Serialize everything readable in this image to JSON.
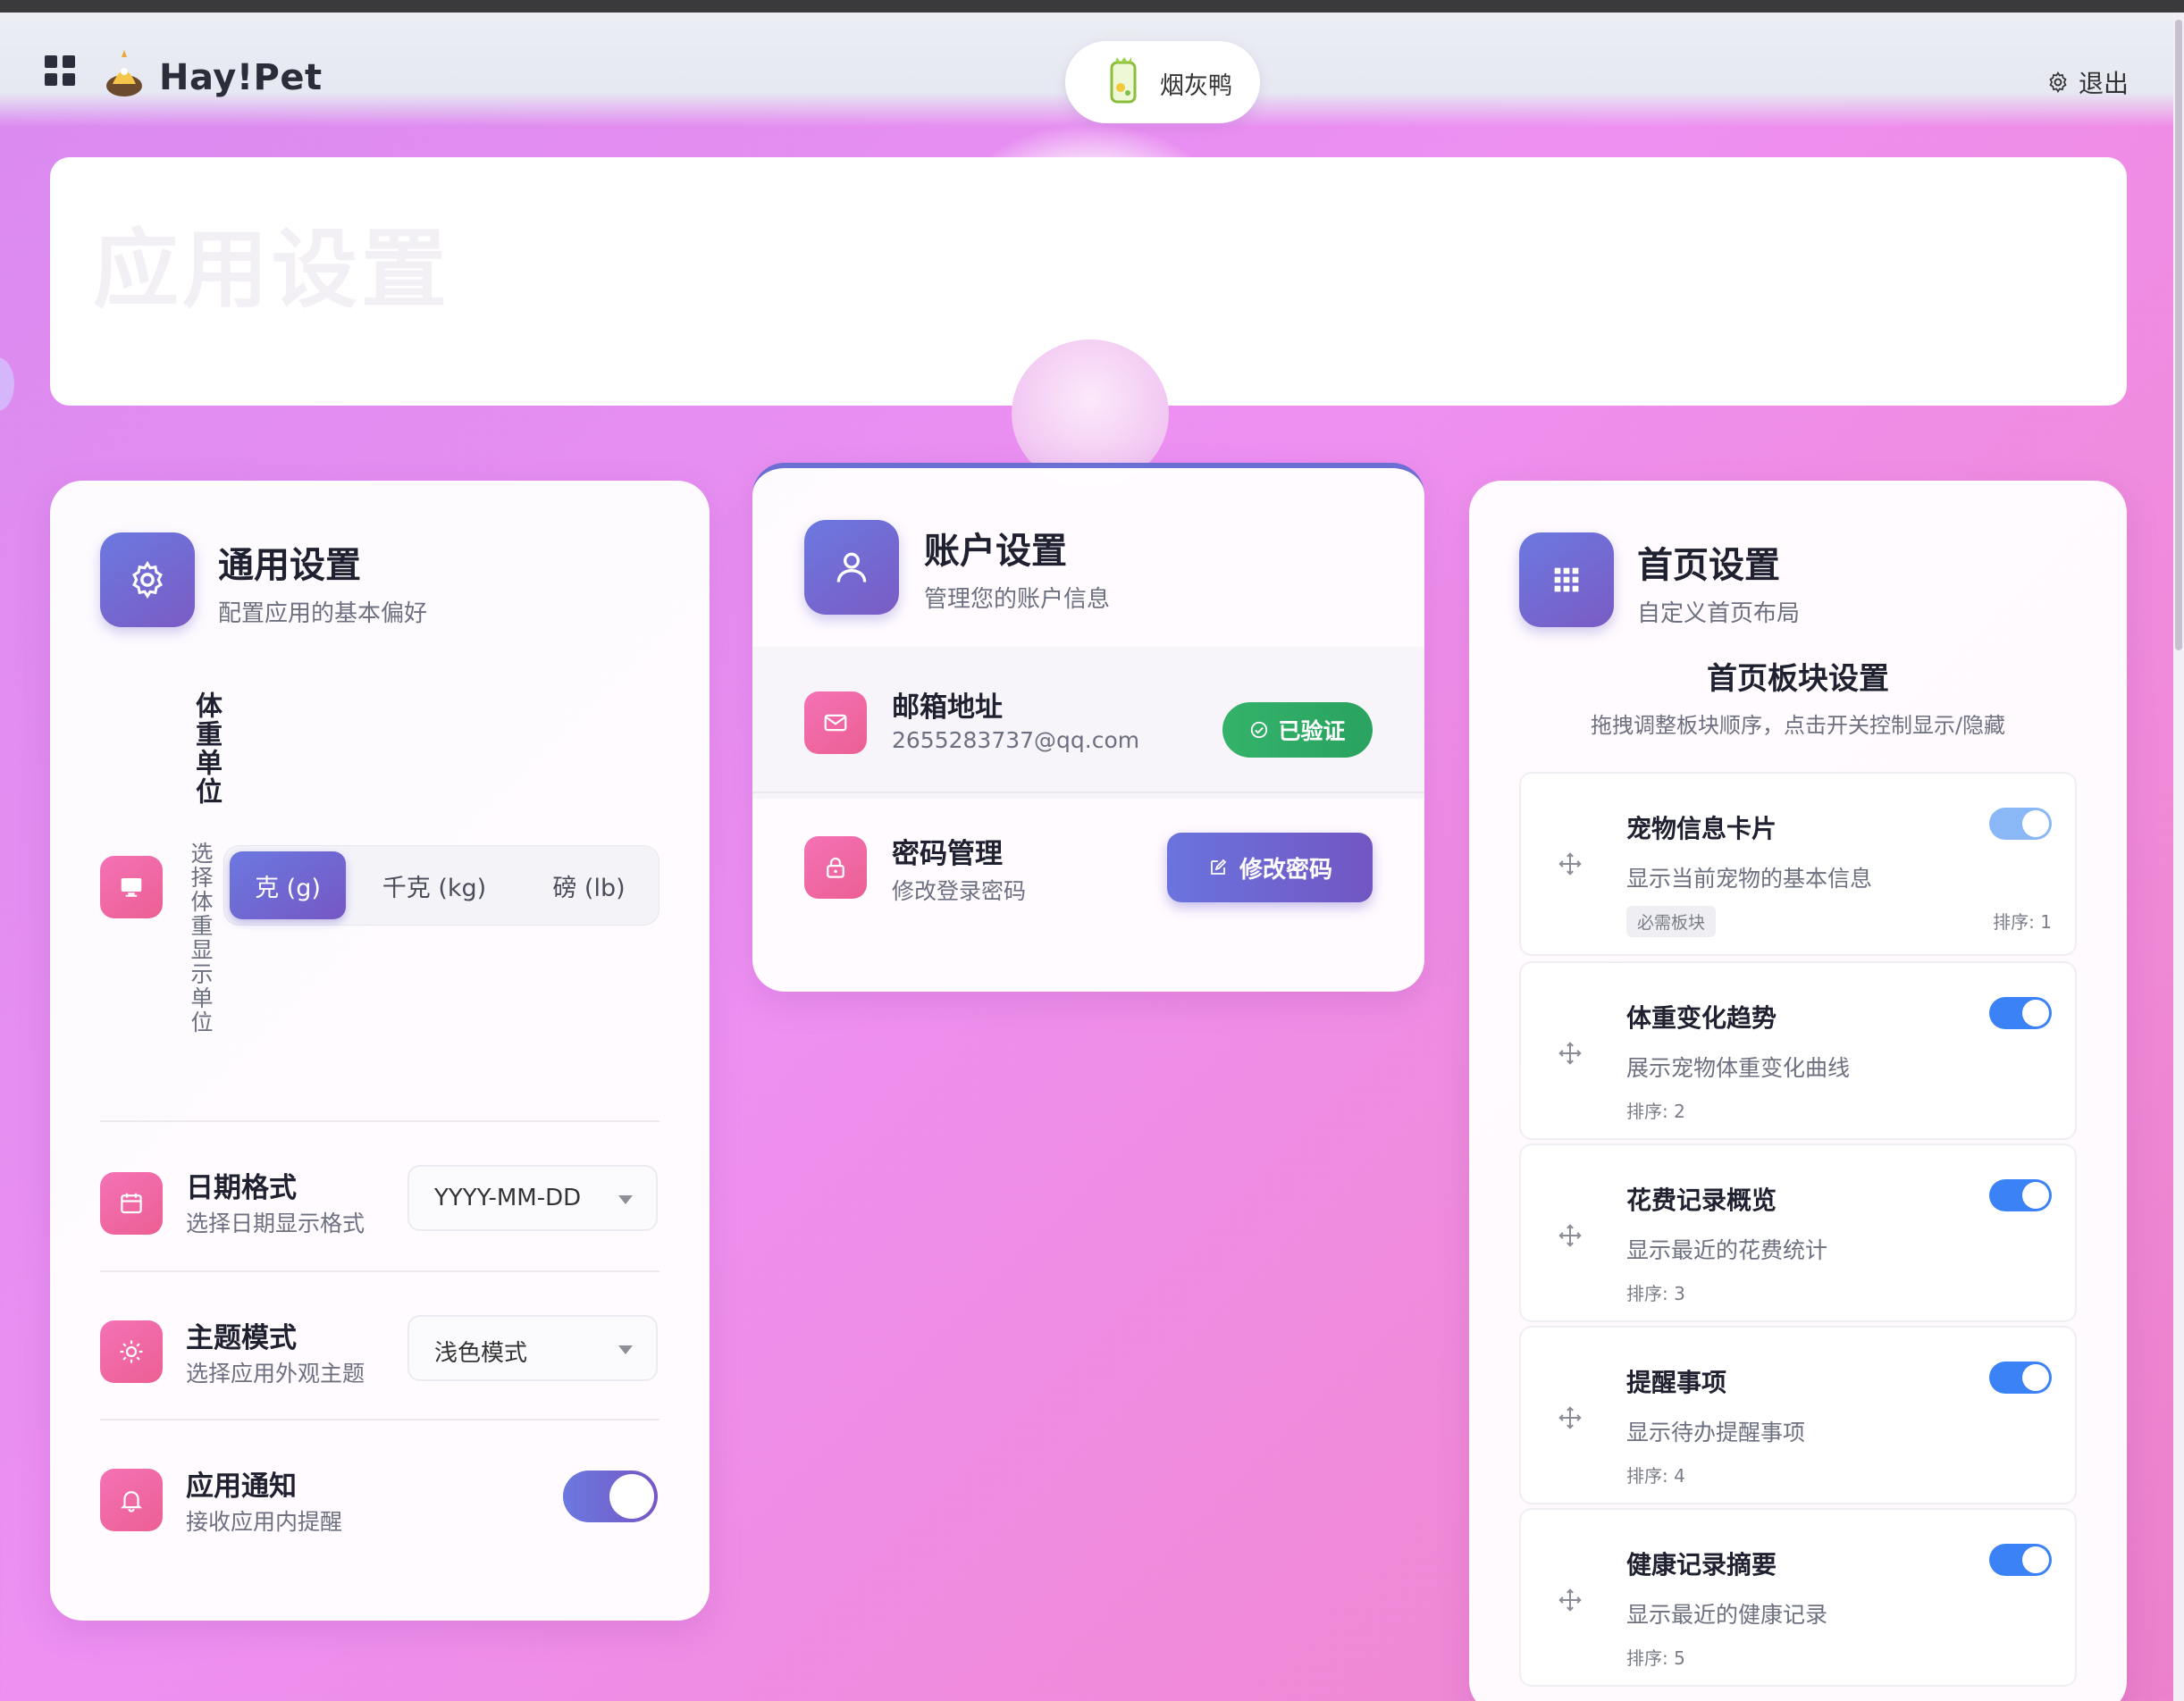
{
  "header": {
    "brand": "Hay!Pet",
    "pet_name": "烟灰鸭",
    "logout_label": "退出"
  },
  "page_title": "应用设置",
  "general": {
    "title": "通用设置",
    "subtitle": "配置应用的基本偏好",
    "weight_unit": {
      "label": "体重单位",
      "desc": "选择体重显示单位",
      "options": [
        "克 (g)",
        "千克 (kg)",
        "磅 (lb)"
      ],
      "selected": "克 (g)"
    },
    "date_format": {
      "label": "日期格式",
      "desc": "选择日期显示格式",
      "value": "YYYY-MM-DD"
    },
    "theme": {
      "label": "主题模式",
      "desc": "选择应用外观主题",
      "value": "浅色模式"
    },
    "notify": {
      "label": "应用通知",
      "desc": "接收应用内提醒",
      "enabled": true
    }
  },
  "account": {
    "title": "账户设置",
    "subtitle": "管理您的账户信息",
    "email": {
      "label": "邮箱地址",
      "value": "2655283737@qq.com",
      "badge": "已验证"
    },
    "password": {
      "label": "密码管理",
      "desc": "修改登录密码",
      "button": "修改密码"
    }
  },
  "home": {
    "title": "首页设置",
    "subtitle": "自定义首页布局",
    "blocks_title": "首页板块设置",
    "blocks_sub": "拖拽调整板块顺序，点击开关控制显示/隐藏",
    "blocks": [
      {
        "name": "宠物信息卡片",
        "desc": "显示当前宠物的基本信息",
        "required_tag": "必需板块",
        "order": "排序: 1",
        "enabled": true
      },
      {
        "name": "体重变化趋势",
        "desc": "展示宠物体重变化曲线",
        "order": "排序: 2",
        "enabled": true
      },
      {
        "name": "花费记录概览",
        "desc": "显示最近的花费统计",
        "order": "排序: 3",
        "enabled": true
      },
      {
        "name": "提醒事项",
        "desc": "显示待办提醒事项",
        "order": "排序: 4",
        "enabled": true
      },
      {
        "name": "健康记录摘要",
        "desc": "显示最近的健康记录",
        "order": "排序: 5",
        "enabled": true
      }
    ]
  },
  "colors": {
    "accent": "#6b79e0",
    "pink_icon": "#f472b6",
    "toggle_blue": "#3b82f6",
    "verified_green": "#2ea864"
  }
}
